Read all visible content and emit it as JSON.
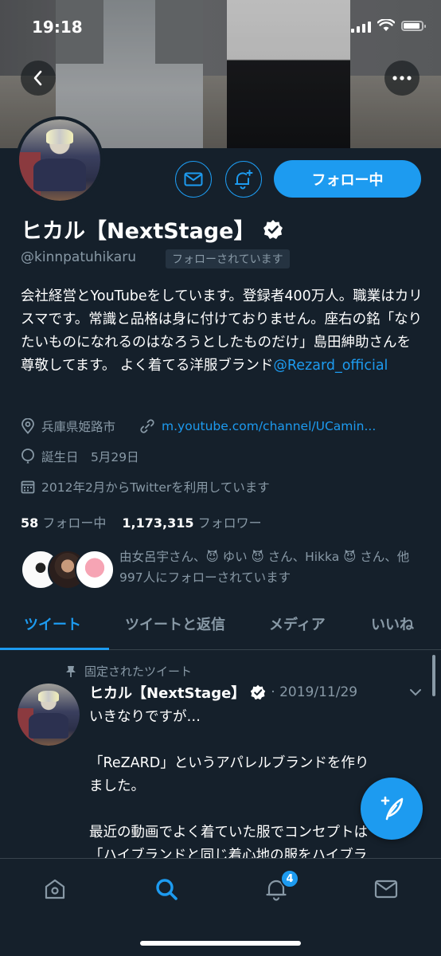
{
  "status_bar": {
    "time": "19:18"
  },
  "profile": {
    "name": "ヒカル【NextStage】",
    "handle": "@kinnpatuhikaru",
    "follows_you": "フォローされています",
    "follow_button": "フォロー中",
    "bio_text": "会社経営とYouTubeをしています。登録者400万人。職業はカリスマです。常識と品格は身に付けておりません。座右の銘「なりたいものになれるのはなろうとしたものだけ」島田紳助さんを尊敬してます。 よく着てる洋服ブランド",
    "bio_link": "@Rezard_official",
    "location": "兵庫県姫路市",
    "website": "m.youtube.com/channel/UCamin...",
    "birthday": "誕生日　5月29日",
    "joined": "2012年2月からTwitterを利用しています",
    "following_count": "58",
    "following_label": "フォロー中",
    "followers_count": "1,173,315",
    "followers_label": "フォロワー",
    "known_followers": "由女呂宇さん、😈 ゆい 😈 さん、Hikka 😈 さん、他997人にフォローされています"
  },
  "tabs": [
    {
      "label": "ツイート"
    },
    {
      "label": "ツイートと返信"
    },
    {
      "label": "メディア"
    },
    {
      "label": "いいね"
    }
  ],
  "tweet": {
    "pinned_label": "固定されたツイート",
    "author": "ヒカル【NextStage】",
    "date": "· 2019/11/29",
    "lines": [
      "いきなりですが…",
      "",
      "「ReZARD」というアパレルブランドを作り",
      "ました。",
      "",
      "最近の動画でよく着ていた服でコンセプトは",
      "「ハイブランドと同じ着心地の服をハイブラ"
    ]
  },
  "nav": {
    "notification_badge": "4"
  },
  "colors": {
    "accent": "#1d9bf0",
    "background": "#15202b",
    "secondary_text": "#8899a6"
  }
}
